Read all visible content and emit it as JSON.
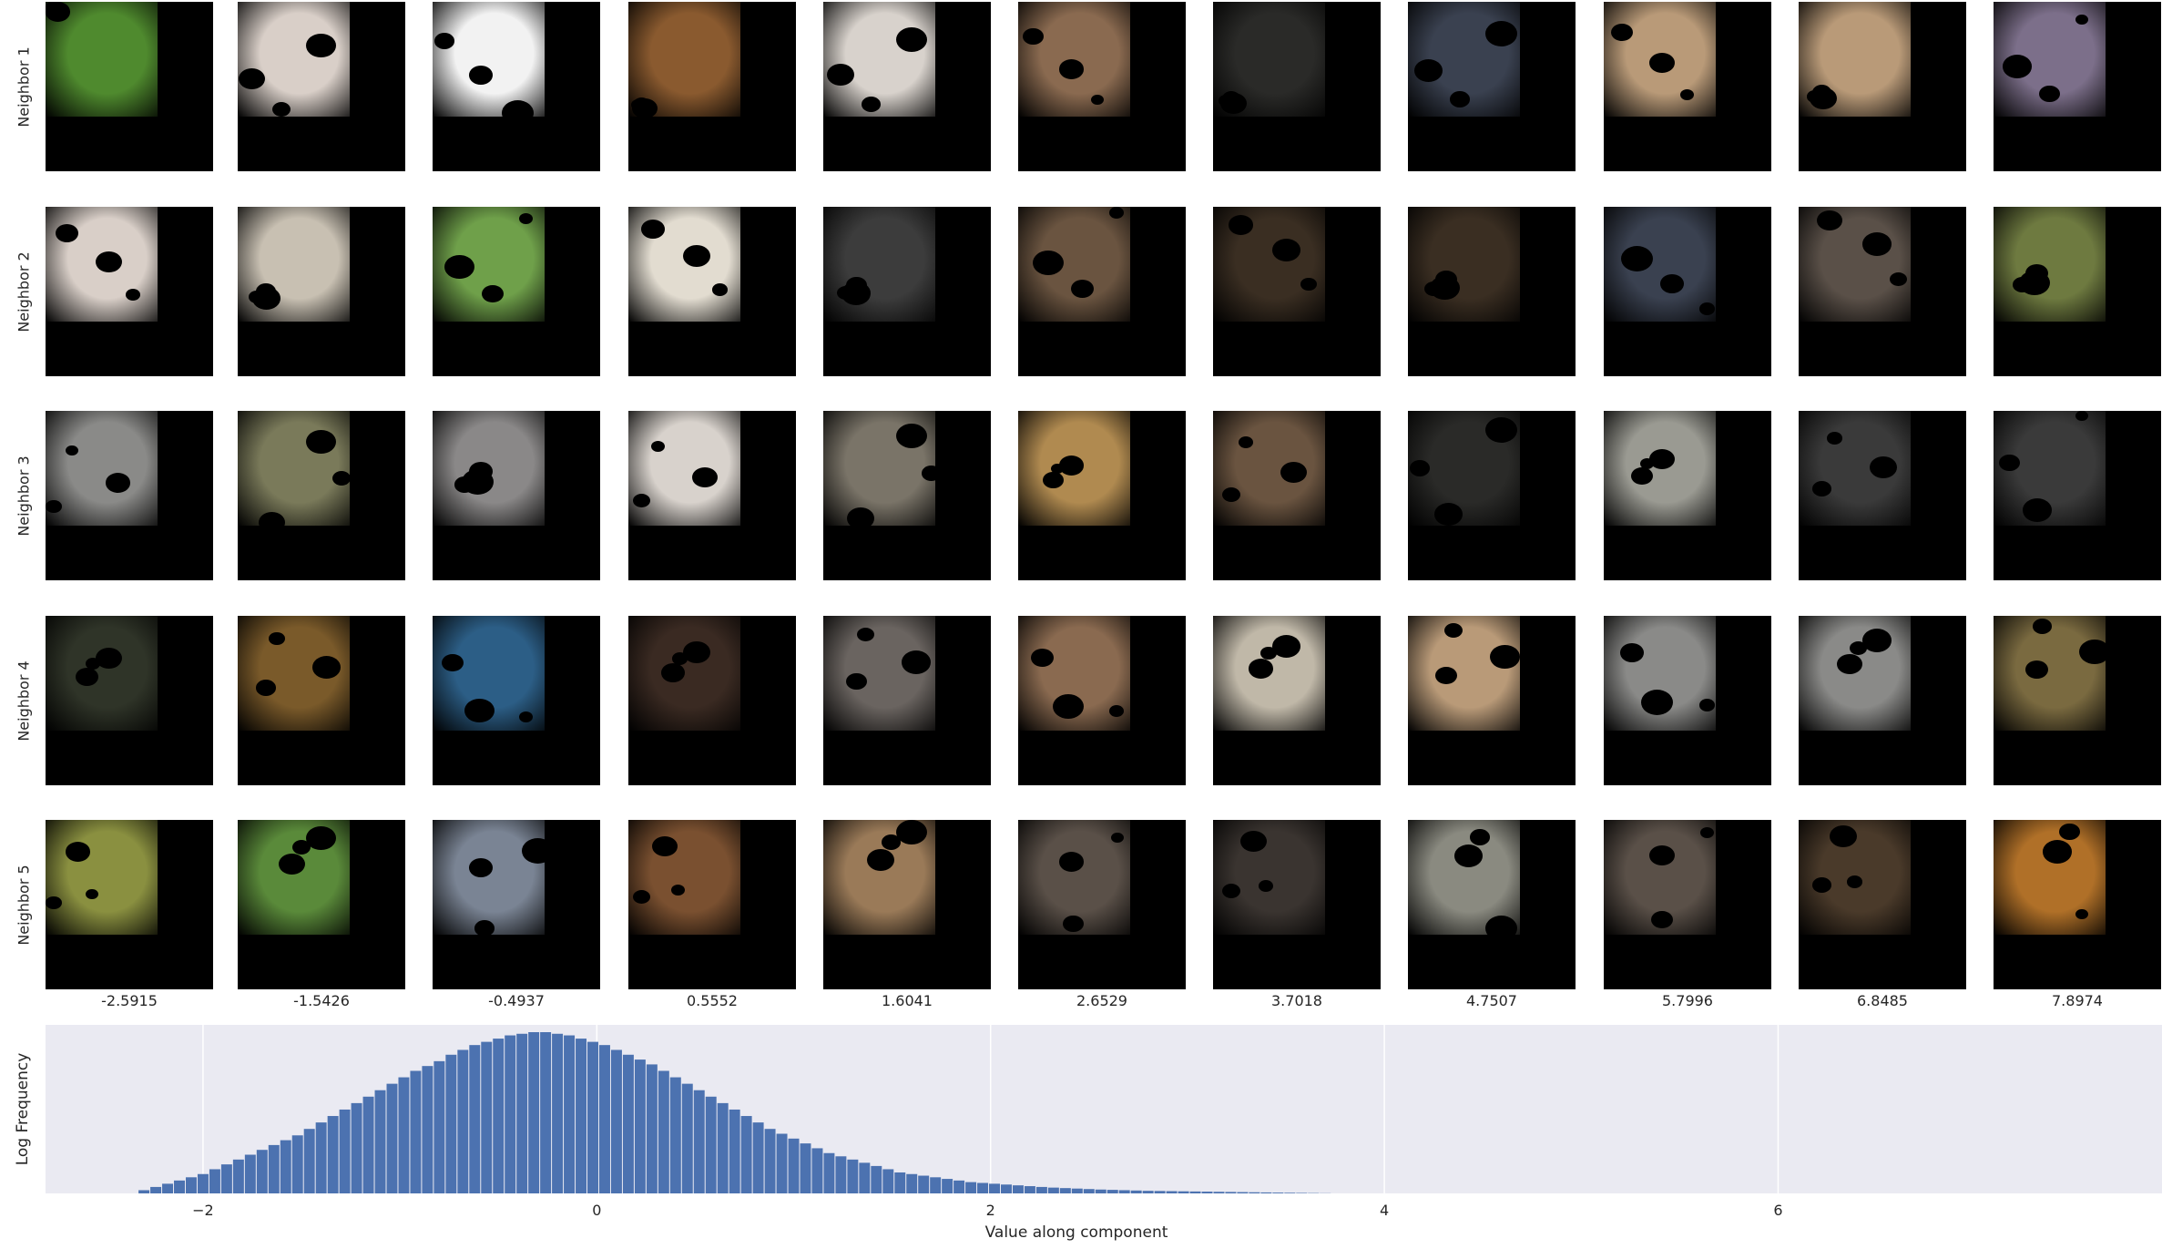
{
  "row_labels": [
    "Neighbor 1",
    "Neighbor 2",
    "Neighbor 3",
    "Neighbor 4",
    "Neighbor 5"
  ],
  "column_values": [
    "-2.5915",
    "-1.5426",
    "-0.4937",
    "0.5552",
    "1.6041",
    "2.6529",
    "3.7018",
    "4.7507",
    "5.7996",
    "6.8485",
    "7.8974"
  ],
  "thumb_colors": [
    [
      "#4f8a2e",
      "#d9cfc8",
      "#f2f2f2",
      "#8a5a2f",
      "#d8d2cc",
      "#8a6a50",
      "#2a2a28",
      "#3a4150",
      "#b99a78",
      "#b99a78",
      "#7c6f8a"
    ],
    [
      "#d9cfc8",
      "#c8c0b2",
      "#6fa04a",
      "#e2dcd0",
      "#3c3c3c",
      "#6a5440",
      "#3a2e22",
      "#3a2e22",
      "#3a4150",
      "#5a5048",
      "#6e7a40"
    ],
    [
      "#8a8a88",
      "#7a7a5a",
      "#8a8888",
      "#d8d2cc",
      "#7a7468",
      "#b08a50",
      "#6a5440",
      "#2a2a28",
      "#9a9a92",
      "#3a3a3a",
      "#3a3a3a"
    ],
    [
      "#2f3428",
      "#7a5a2a",
      "#2c5e86",
      "#3a2a22",
      "#6a6460",
      "#8a6a50",
      "#c0b8a8",
      "#b99a78",
      "#8a8a88",
      "#8a8a88",
      "#7a6a40"
    ],
    [
      "#8a9040",
      "#5a8a3a",
      "#7a8494",
      "#7a5030",
      "#9a7a58",
      "#5a5048",
      "#3a3430",
      "#8a8a80",
      "#5a5048",
      "#4a3a2a",
      "#b07028"
    ]
  ],
  "chart_data": {
    "type": "bar",
    "xlabel": "Value along component",
    "ylabel": "Log Frequency",
    "xlim": [
      -2.8,
      7.95
    ],
    "x_ticks": [
      -2,
      0,
      2,
      4,
      6
    ],
    "grid": true,
    "bar_color": "#4c72b0",
    "background": "#eaeaf2",
    "x": [
      -2.3,
      -2.24,
      -2.18,
      -2.12,
      -2.06,
      -2.0,
      -1.94,
      -1.88,
      -1.82,
      -1.76,
      -1.7,
      -1.64,
      -1.58,
      -1.52,
      -1.46,
      -1.4,
      -1.34,
      -1.28,
      -1.22,
      -1.16,
      -1.1,
      -1.04,
      -0.98,
      -0.92,
      -0.86,
      -0.8,
      -0.74,
      -0.68,
      -0.62,
      -0.56,
      -0.5,
      -0.44,
      -0.38,
      -0.32,
      -0.26,
      -0.2,
      -0.14,
      -0.08,
      -0.02,
      0.04,
      0.1,
      0.16,
      0.22,
      0.28,
      0.34,
      0.4,
      0.46,
      0.52,
      0.58,
      0.64,
      0.7,
      0.76,
      0.82,
      0.88,
      0.94,
      1.0,
      1.06,
      1.12,
      1.18,
      1.24,
      1.3,
      1.36,
      1.42,
      1.48,
      1.54,
      1.6,
      1.66,
      1.72,
      1.78,
      1.84,
      1.9,
      1.96,
      2.02,
      2.08,
      2.14,
      2.2,
      2.26,
      2.32,
      2.38,
      2.44,
      2.5,
      2.56,
      2.62,
      2.68,
      2.74,
      2.8,
      2.86,
      2.92,
      2.98,
      3.04,
      3.1,
      3.16,
      3.22,
      3.28,
      3.34,
      3.4,
      3.46,
      3.52,
      3.58,
      3.64,
      3.7
    ],
    "values": [
      0.02,
      0.04,
      0.06,
      0.08,
      0.1,
      0.12,
      0.15,
      0.18,
      0.21,
      0.24,
      0.27,
      0.3,
      0.33,
      0.36,
      0.4,
      0.44,
      0.48,
      0.52,
      0.56,
      0.6,
      0.64,
      0.68,
      0.72,
      0.76,
      0.79,
      0.82,
      0.86,
      0.89,
      0.92,
      0.94,
      0.96,
      0.98,
      0.99,
      1.0,
      1.0,
      0.99,
      0.98,
      0.96,
      0.94,
      0.92,
      0.89,
      0.86,
      0.83,
      0.8,
      0.76,
      0.72,
      0.68,
      0.64,
      0.6,
      0.56,
      0.52,
      0.48,
      0.44,
      0.4,
      0.37,
      0.34,
      0.31,
      0.28,
      0.25,
      0.23,
      0.21,
      0.19,
      0.17,
      0.15,
      0.13,
      0.12,
      0.11,
      0.1,
      0.09,
      0.08,
      0.07,
      0.065,
      0.06,
      0.055,
      0.05,
      0.045,
      0.04,
      0.036,
      0.033,
      0.03,
      0.027,
      0.024,
      0.022,
      0.02,
      0.018,
      0.016,
      0.015,
      0.014,
      0.013,
      0.012,
      0.011,
      0.01,
      0.009,
      0.008,
      0.007,
      0.006,
      0.005,
      0.004,
      0.003,
      0.002,
      0.001
    ]
  }
}
